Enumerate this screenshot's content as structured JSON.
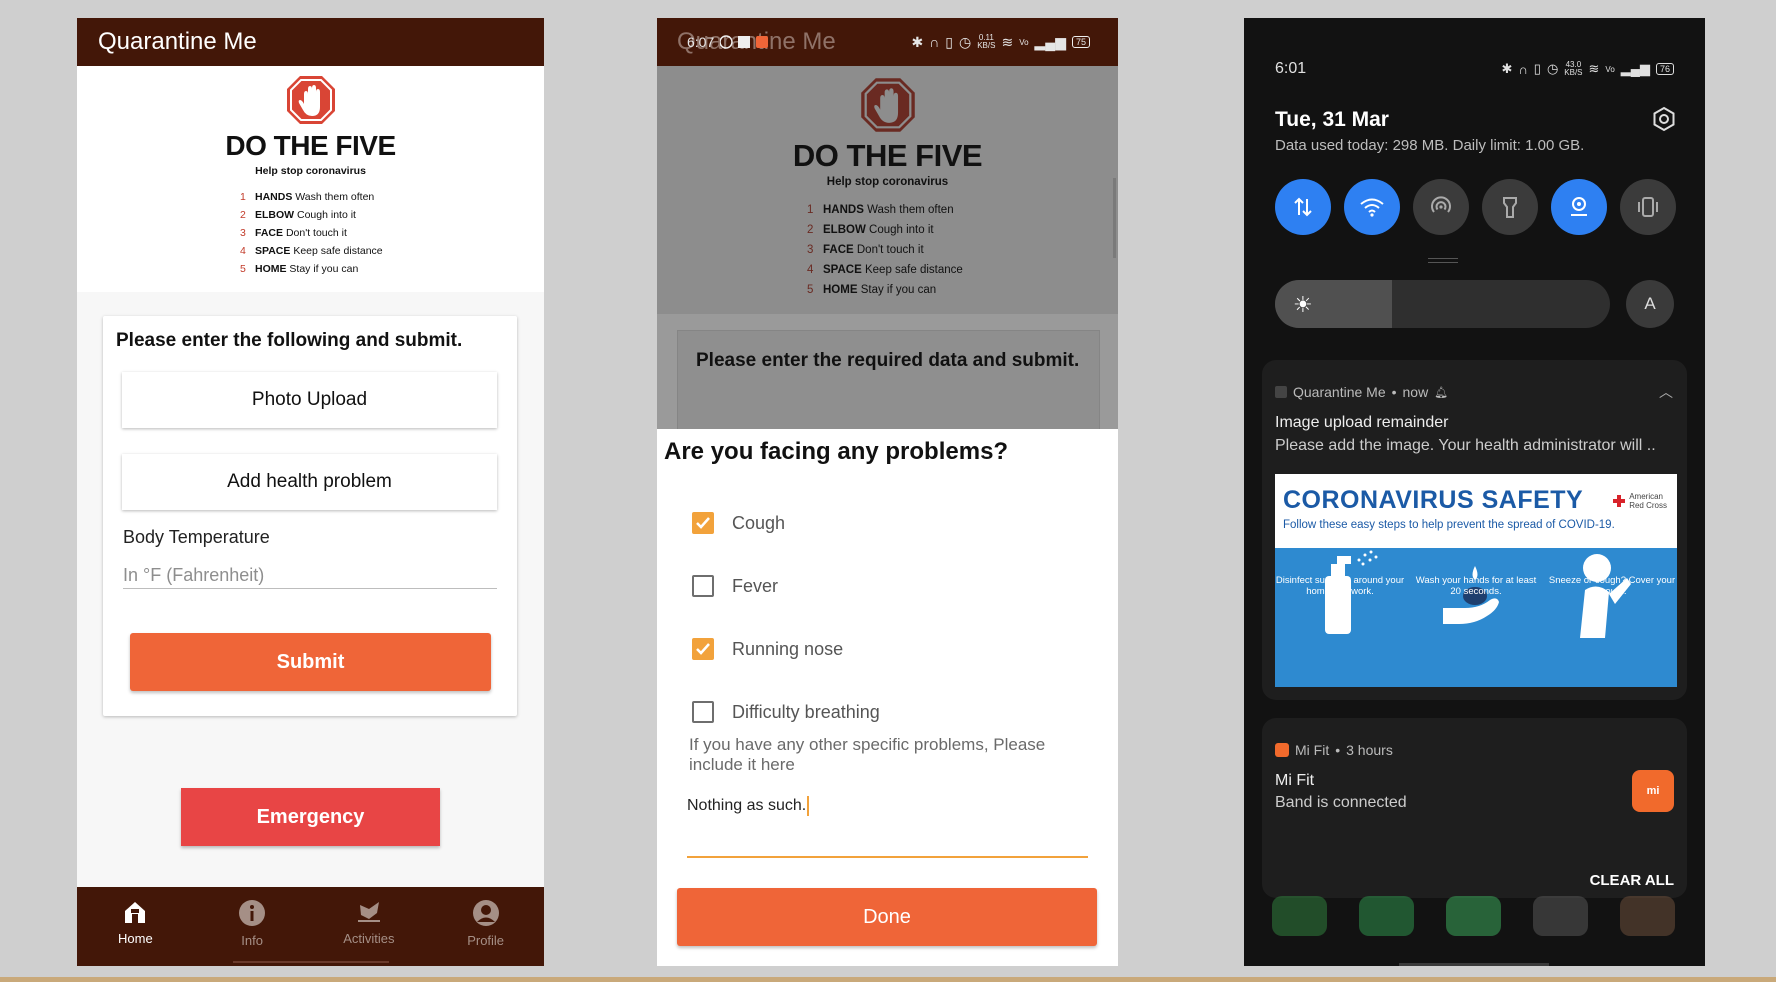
{
  "screen1": {
    "app_title": "Quarantine Me",
    "poster": {
      "title": "DO THE FIVE",
      "subtitle": "Help stop coronavirus",
      "steps": [
        {
          "num": "1",
          "bold": "HANDS",
          "text": "Wash them often"
        },
        {
          "num": "2",
          "bold": "ELBOW",
          "text": "Cough into it"
        },
        {
          "num": "3",
          "bold": "FACE",
          "text": "Don't touch it"
        },
        {
          "num": "4",
          "bold": "SPACE",
          "text": "Keep safe distance"
        },
        {
          "num": "5",
          "bold": "HOME",
          "text": "Stay if you can"
        }
      ]
    },
    "form": {
      "heading": "Please enter the following and submit.",
      "photo_upload": "Photo Upload",
      "add_health_problem": "Add health problem",
      "temp_label": "Body Temperature",
      "temp_placeholder": "In °F (Fahrenheit)",
      "submit": "Submit"
    },
    "emergency": "Emergency",
    "nav": [
      {
        "label": "Home",
        "icon": "home-icon"
      },
      {
        "label": "Info",
        "icon": "info-icon"
      },
      {
        "label": "Activities",
        "icon": "activities-icon"
      },
      {
        "label": "Profile",
        "icon": "profile-icon"
      }
    ]
  },
  "screen2": {
    "app_title": "Quarantine Me",
    "status_time": "6:07",
    "status_speed_top": "0.11",
    "status_speed_bottom": "KB/S",
    "status_battery": "75",
    "form_heading": "Please enter the required data and submit.",
    "dialog": {
      "title": "Are you facing any problems?",
      "options": [
        {
          "label": "Cough",
          "checked": true
        },
        {
          "label": "Fever",
          "checked": false
        },
        {
          "label": "Running nose",
          "checked": true
        },
        {
          "label": "Difficulty breathing",
          "checked": false
        }
      ],
      "other_hint": "If you have any other specific problems, Please include it here",
      "other_value": "Nothing as such.",
      "done": "Done"
    }
  },
  "screen3": {
    "status_time": "6:01",
    "status_speed_top": "43.0",
    "status_speed_bottom": "KB/S",
    "status_battery": "76",
    "date": "Tue, 31 Mar",
    "data_usage": "Data used today: 298 MB. Daily limit: 1.00 GB.",
    "tiles": [
      {
        "icon": "mobile-data-icon",
        "on": true
      },
      {
        "icon": "wifi-icon",
        "on": true
      },
      {
        "icon": "hotspot-icon",
        "on": false
      },
      {
        "icon": "flashlight-icon",
        "on": false
      },
      {
        "icon": "location-icon",
        "on": true
      },
      {
        "icon": "vibrate-icon",
        "on": false
      }
    ],
    "brightness_level": 0.35,
    "auto_brightness": "A",
    "notification1": {
      "app": "Quarantine Me",
      "time": "now",
      "title": "Image upload remainder",
      "text": "Please add the image. Your health administrator will ..",
      "image": {
        "title": "CORONAVIRUS SAFETY",
        "subtitle": "Follow these easy steps to help prevent the spread of COVID-19.",
        "org_line1": "American",
        "org_line2": "Red Cross",
        "tips": [
          "Disinfect surfaces around your home and work.",
          "Wash your hands for at least 20 seconds.",
          "Sneeze or cough? Cover your mouth."
        ]
      }
    },
    "notification2": {
      "app": "Mi Fit",
      "time": "3 hours",
      "title": "Mi Fit",
      "text": "Band is connected",
      "badge": "mi"
    },
    "clear_all": "CLEAR ALL",
    "colors": {
      "accent": "#2e80f2",
      "orange": "#ef6538",
      "brown": "#431708"
    }
  }
}
